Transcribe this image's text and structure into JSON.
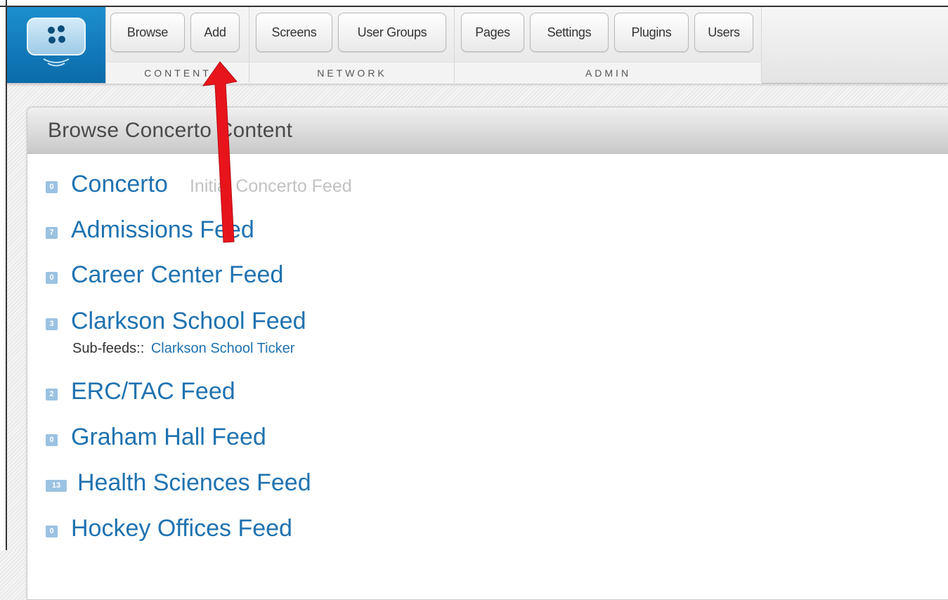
{
  "nav": {
    "groups": [
      {
        "label": "CONTENT",
        "buttons": [
          "Browse",
          "Add"
        ]
      },
      {
        "label": "NETWORK",
        "buttons": [
          "Screens",
          "User Groups"
        ]
      },
      {
        "label": "ADMIN",
        "buttons": [
          "Pages",
          "Settings",
          "Plugins",
          "Users"
        ]
      }
    ]
  },
  "icons": {
    "logo": "concerto-logo-icon",
    "annotation": "red-arrow-annotation"
  },
  "colors": {
    "logo_bg": "#0b6aa9",
    "link": "#1f72b0",
    "badge": "#9bc2e2",
    "annotation_arrow": "#e8141c"
  },
  "panel": {
    "title": "Browse Concerto Content",
    "feeds": [
      {
        "count": "0",
        "name": "Concerto",
        "description": "Initial Concerto Feed"
      },
      {
        "count": "7",
        "name": "Admissions Feed"
      },
      {
        "count": "0",
        "name": "Career Center Feed"
      },
      {
        "count": "3",
        "name": "Clarkson School Feed",
        "subfeeds_label": "Sub-feeds::",
        "subfeeds": [
          "Clarkson School Ticker"
        ]
      },
      {
        "count": "2",
        "name": "ERC/TAC Feed"
      },
      {
        "count": "0",
        "name": "Graham Hall Feed"
      },
      {
        "count": "13",
        "name": "Health Sciences Feed"
      },
      {
        "count": "0",
        "name": "Hockey Offices Feed"
      }
    ]
  }
}
